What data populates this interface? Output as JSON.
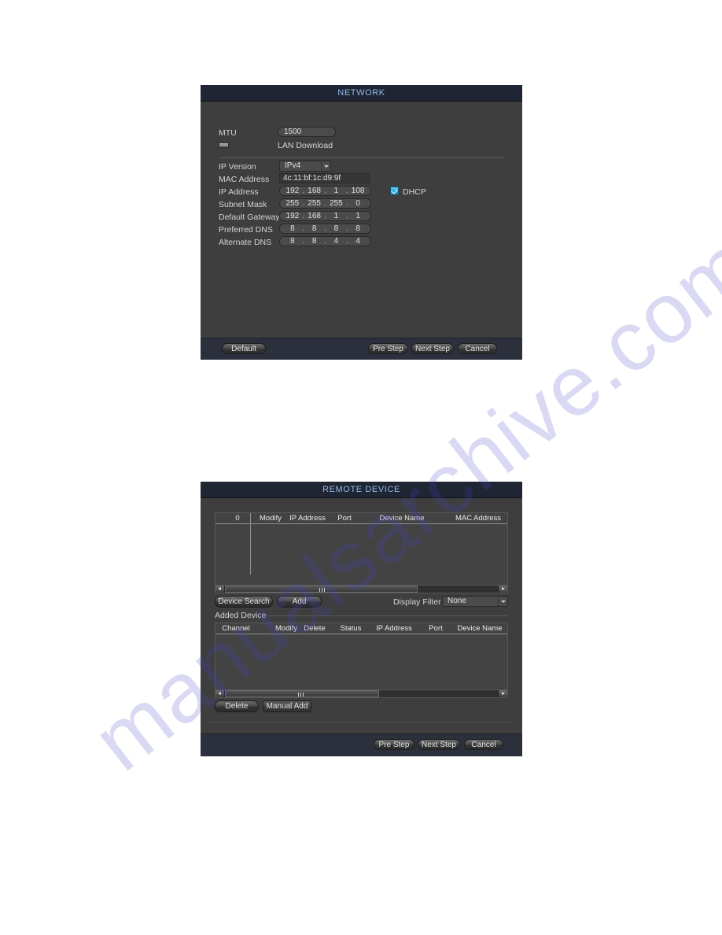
{
  "watermark": {
    "text": "manualsarchive.com"
  },
  "dialog_network": {
    "title": "NETWORK",
    "mtu": {
      "label": "MTU",
      "value": "1500"
    },
    "lan_download": {
      "label": "LAN Download"
    },
    "fields": [
      {
        "label": "IP Version",
        "type": "select",
        "value": "IPv4"
      },
      {
        "label": "MAC Address",
        "type": "text",
        "value": "4c:11:bf:1c:d9:9f"
      },
      {
        "label": "IP Address",
        "type": "ip",
        "octets": [
          "192",
          "168",
          "1",
          "108"
        ]
      },
      {
        "label": "Subnet Mask",
        "type": "ip",
        "octets": [
          "255",
          "255",
          "255",
          "0"
        ]
      },
      {
        "label": "Default Gateway",
        "type": "ip",
        "octets": [
          "192",
          "168",
          "1",
          "1"
        ]
      },
      {
        "label": "Preferred DNS",
        "type": "ip",
        "octets": [
          "8",
          "8",
          "8",
          "8"
        ]
      },
      {
        "label": "Alternate DNS",
        "type": "ip",
        "octets": [
          "8",
          "8",
          "4",
          "4"
        ]
      }
    ],
    "dhcp": {
      "label": "DHCP",
      "checked": true
    },
    "footer": {
      "default_label": "Default",
      "pre_step_label": "Pre Step",
      "next_step_label": "Next Step",
      "cancel_label": "Cancel"
    }
  },
  "dialog_remote_device": {
    "title": "REMOTE DEVICE",
    "search_table": {
      "columns": [
        "0",
        "Modify",
        "IP Address",
        "Port",
        "Device Name",
        "MAC Address"
      ],
      "rows": []
    },
    "actions": {
      "device_search_label": "Device Search",
      "add_label": "Add",
      "display_filter_label": "Display Filter",
      "display_filter_value": "None"
    },
    "added_device": {
      "section_label": "Added Device",
      "columns": [
        "Channel",
        "Modify",
        "Delete",
        "Status",
        "IP Address",
        "Port",
        "Device Name"
      ],
      "rows": [],
      "delete_label": "Delete",
      "manual_add_label": "Manual Add"
    },
    "footer": {
      "pre_step_label": "Pre Step",
      "next_step_label": "Next Step",
      "cancel_label": "Cancel"
    }
  },
  "colors": {
    "title_bar": "#1f2533",
    "title_text": "#8fb8e8",
    "dialog_body": "#3e3e3e",
    "footer": "#2b303c",
    "checkbox_accent": "#2fa8d8",
    "page_background": "#ffffff"
  }
}
